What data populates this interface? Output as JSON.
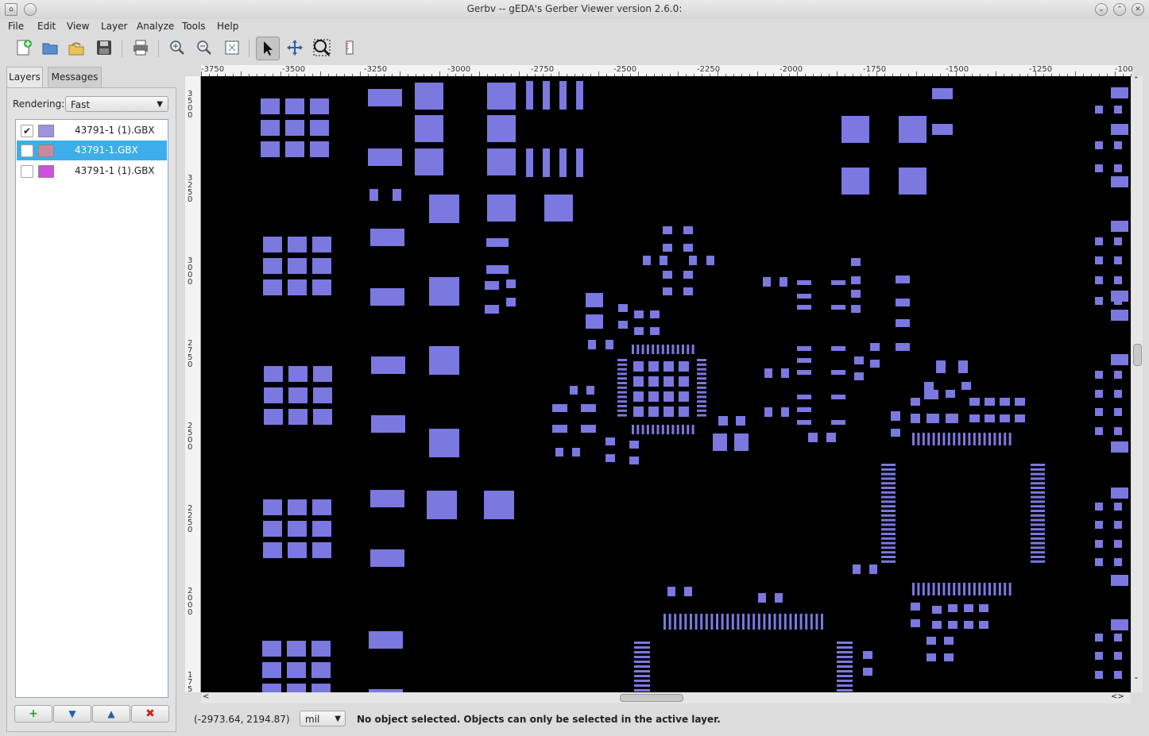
{
  "window": {
    "title": "Gerbv -- gEDA's Gerber Viewer version 2.6.0:"
  },
  "menu": [
    "File",
    "Edit",
    "View",
    "Layer",
    "Analyze",
    "Tools",
    "Help"
  ],
  "toolbar_icons": [
    "new-project-icon",
    "open-icon",
    "revert-icon",
    "save-icon",
    "print-icon",
    "zoom-in-icon",
    "zoom-out-icon",
    "zoom-fit-icon",
    "pointer-tool-icon",
    "pan-tool-icon",
    "zoom-tool-icon",
    "measure-tool-icon"
  ],
  "tabs": [
    "Layers",
    "Messages"
  ],
  "rendering": {
    "label": "Rendering:",
    "value": "Fast"
  },
  "layers": [
    {
      "name": "43791-1 (1).GBX",
      "checked": true,
      "color": "#9b95e0",
      "selected": false
    },
    {
      "name": "43791-1.GBX",
      "checked": false,
      "color": "#c98a9d",
      "selected": true
    },
    {
      "name": "43791-1 (1).GBX",
      "checked": false,
      "color": "#cf4fe0",
      "selected": false
    }
  ],
  "layer_buttons": {
    "add": "+",
    "down": "▼",
    "up": "▲",
    "remove": "✖"
  },
  "ruler": {
    "h_labels": [
      "-3750",
      "-3500",
      "-3250",
      "-3000",
      "-2750",
      "-2500",
      "-2250",
      "-2000",
      "-1750",
      "-1500",
      "-1250",
      "-100"
    ],
    "v_labels": [
      "3500",
      "3250",
      "3000",
      "2750",
      "2500",
      "2250",
      "2000",
      "175"
    ]
  },
  "status": {
    "coords": "(-2973.64,  2194.87)",
    "units": "mil",
    "message": "No object selected. Objects can only be selected in the active layer."
  },
  "colors": {
    "pad": "#7b78e0",
    "canvas_bg": "#000000",
    "selection": "#3daee9"
  }
}
